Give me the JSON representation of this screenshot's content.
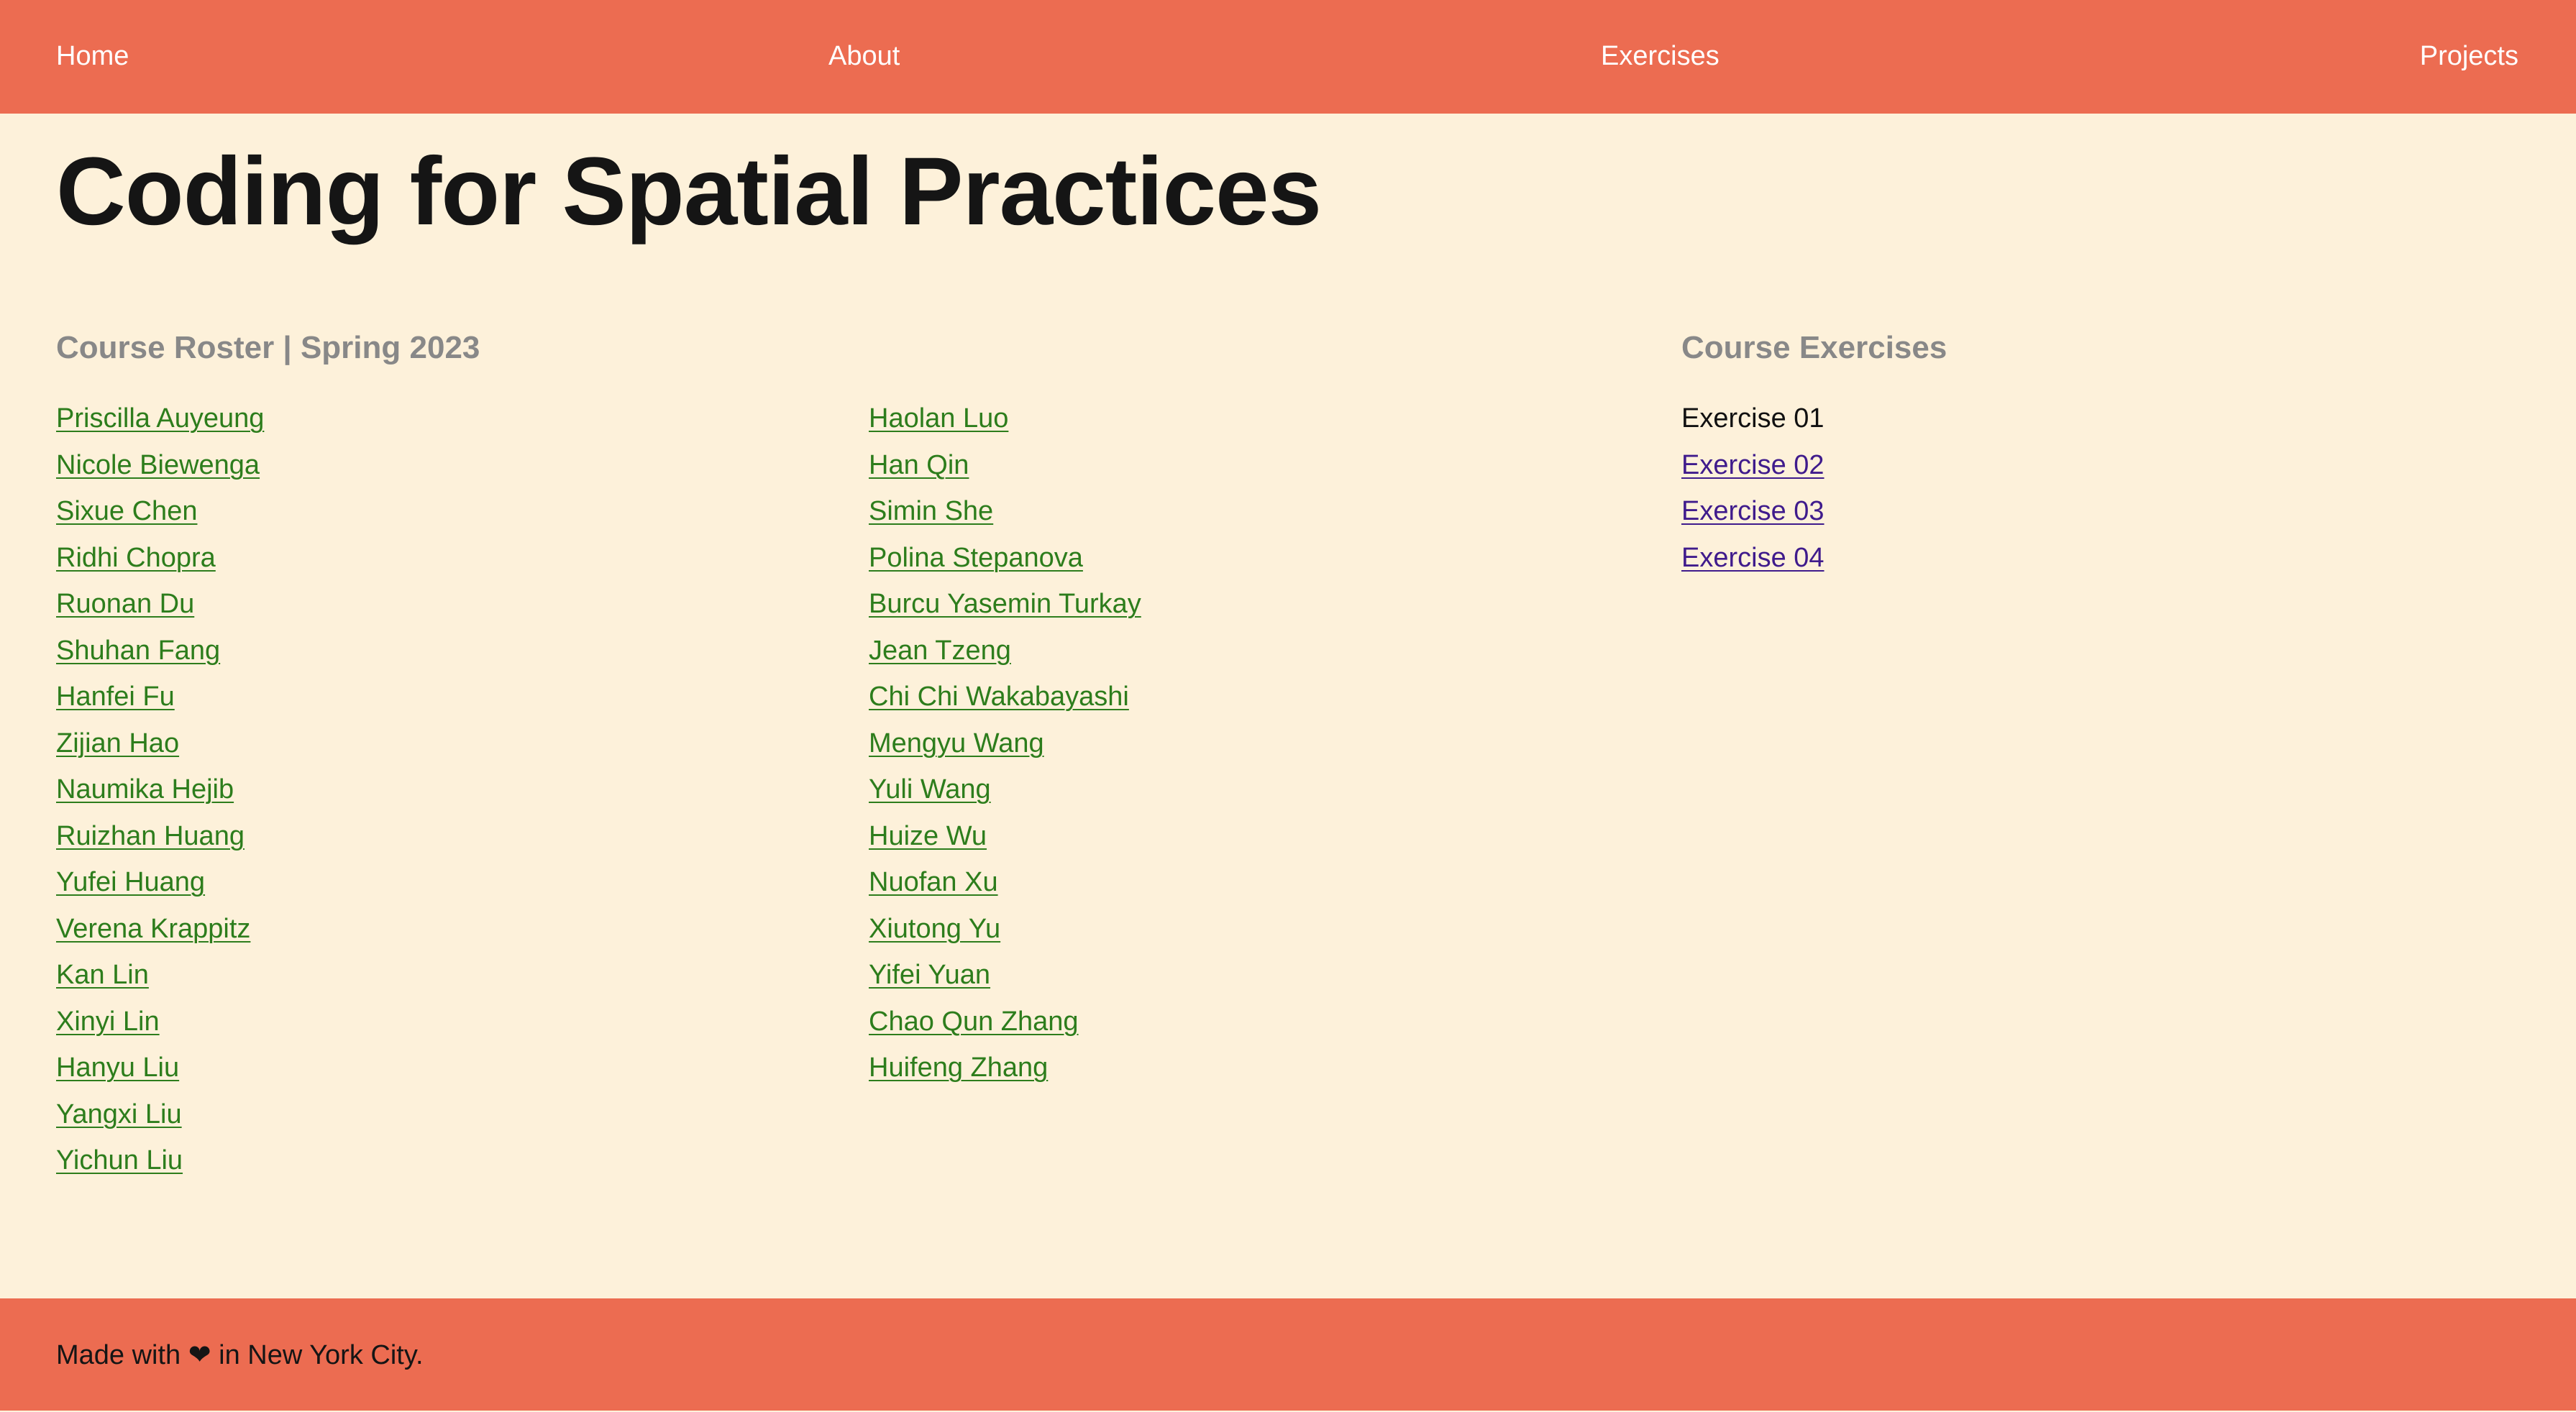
{
  "nav": {
    "home": "Home",
    "about": "About",
    "exercises": "Exercises",
    "projects": "Projects"
  },
  "page": {
    "title": "Coding for Spatial Practices"
  },
  "roster": {
    "heading": "Course Roster | Spring 2023",
    "column_1": [
      "Priscilla Auyeung",
      "Nicole Biewenga",
      "Sixue Chen",
      "Ridhi Chopra",
      "Ruonan Du",
      "Shuhan Fang",
      "Hanfei Fu",
      "Zijian Hao",
      "Naumika Hejib",
      "Ruizhan Huang",
      "Yufei Huang",
      "Verena Krappitz",
      "Kan Lin",
      "Xinyi Lin",
      "Hanyu Liu",
      "Yangxi Liu",
      "Yichun Liu"
    ],
    "column_2": [
      "Haolan Luo",
      "Han Qin",
      "Simin She",
      "Polina Stepanova",
      "Burcu Yasemin Turkay",
      "Jean Tzeng",
      "Chi Chi Wakabayashi",
      "Mengyu Wang",
      "Yuli Wang",
      "Huize Wu",
      "Nuofan Xu",
      "Xiutong Yu",
      "Yifei Yuan",
      "Chao Qun Zhang",
      "Huifeng Zhang"
    ]
  },
  "exercises": {
    "heading": "Course Exercises",
    "items": [
      {
        "label": "Exercise 01",
        "current": true
      },
      {
        "label": "Exercise 02",
        "current": false
      },
      {
        "label": "Exercise 03",
        "current": false
      },
      {
        "label": "Exercise 04",
        "current": false
      }
    ]
  },
  "footer": {
    "prefix": "Made with",
    "heart": "❤",
    "suffix": "in New York City."
  },
  "colors": {
    "header_footer_bg": "#ec6c51",
    "page_bg": "#fdf1da",
    "student_link": "#2d7d1c",
    "exercise_link": "#3f1b8c",
    "section_heading": "#888888"
  }
}
